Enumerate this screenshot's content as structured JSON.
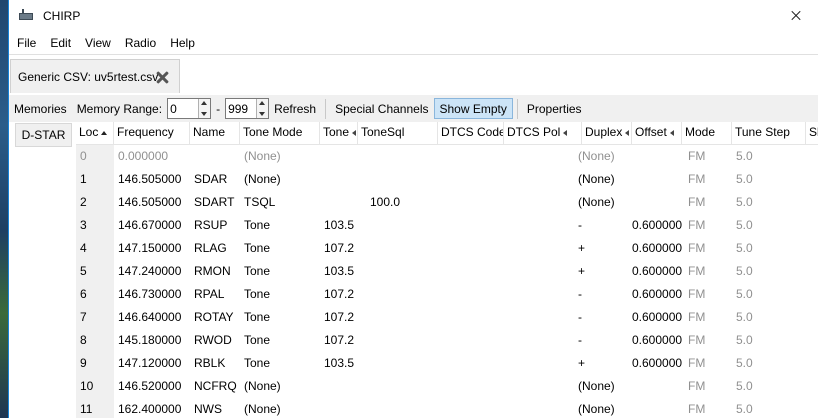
{
  "window": {
    "title": "CHIRP"
  },
  "menu": [
    "File",
    "Edit",
    "View",
    "Radio",
    "Help"
  ],
  "tab": {
    "label": "Generic CSV: uv5rtest.csv"
  },
  "toolbar": {
    "memories_label": "Memories",
    "memory_range_label": "Memory Range:",
    "range_start": "0",
    "range_sep": "-",
    "range_end": "999",
    "refresh": "Refresh",
    "special_channels": "Special Channels",
    "show_empty": "Show Empty",
    "properties": "Properties"
  },
  "sidebar": {
    "tab": "D-STAR"
  },
  "columns": [
    "Loc",
    "Frequency",
    "Name",
    "Tone Mode",
    "Tone",
    "ToneSql",
    "DTCS Code",
    "DTCS Pol",
    "Duplex",
    "Offset",
    "Mode",
    "Tune Step",
    "Sk"
  ],
  "rows": [
    {
      "loc": "0",
      "freq": "0.000000",
      "name": "",
      "tmode": "(None)",
      "tone": "",
      "tsql": "",
      "duplex": "(None)",
      "offset": "",
      "mode": "FM",
      "step": "5.0",
      "empty": true
    },
    {
      "loc": "1",
      "freq": "146.505000",
      "name": "SDAR",
      "tmode": "(None)",
      "tone": "",
      "tsql": "",
      "duplex": "(None)",
      "offset": "",
      "mode": "FM",
      "step": "5.0"
    },
    {
      "loc": "2",
      "freq": "146.505000",
      "name": "SDART",
      "tmode": "TSQL",
      "tone": "",
      "tsql": "100.0",
      "duplex": "(None)",
      "offset": "",
      "mode": "FM",
      "step": "5.0"
    },
    {
      "loc": "3",
      "freq": "146.670000",
      "name": "RSUP",
      "tmode": "Tone",
      "tone": "103.5",
      "tsql": "",
      "duplex": "-",
      "offset": "0.600000",
      "mode": "FM",
      "step": "5.0"
    },
    {
      "loc": "4",
      "freq": "147.150000",
      "name": "RLAG",
      "tmode": "Tone",
      "tone": "107.2",
      "tsql": "",
      "duplex": "+",
      "offset": "0.600000",
      "mode": "FM",
      "step": "5.0"
    },
    {
      "loc": "5",
      "freq": "147.240000",
      "name": "RMON",
      "tmode": "Tone",
      "tone": "103.5",
      "tsql": "",
      "duplex": "+",
      "offset": "0.600000",
      "mode": "FM",
      "step": "5.0"
    },
    {
      "loc": "6",
      "freq": "146.730000",
      "name": "RPAL",
      "tmode": "Tone",
      "tone": "107.2",
      "tsql": "",
      "duplex": "-",
      "offset": "0.600000",
      "mode": "FM",
      "step": "5.0"
    },
    {
      "loc": "7",
      "freq": "146.640000",
      "name": "ROTAY",
      "tmode": "Tone",
      "tone": "107.2",
      "tsql": "",
      "duplex": "-",
      "offset": "0.600000",
      "mode": "FM",
      "step": "5.0"
    },
    {
      "loc": "8",
      "freq": "145.180000",
      "name": "RWOD",
      "tmode": "Tone",
      "tone": "107.2",
      "tsql": "",
      "duplex": "-",
      "offset": "0.600000",
      "mode": "FM",
      "step": "5.0"
    },
    {
      "loc": "9",
      "freq": "147.120000",
      "name": "RBLK",
      "tmode": "Tone",
      "tone": "103.5",
      "tsql": "",
      "duplex": "+",
      "offset": "0.600000",
      "mode": "FM",
      "step": "5.0"
    },
    {
      "loc": "10",
      "freq": "146.520000",
      "name": "NCFRQ",
      "tmode": "(None)",
      "tone": "",
      "tsql": "",
      "duplex": "(None)",
      "offset": "",
      "mode": "FM",
      "step": "5.0"
    },
    {
      "loc": "11",
      "freq": "162.400000",
      "name": "NWS",
      "tmode": "(None)",
      "tone": "",
      "tsql": "",
      "duplex": "(None)",
      "offset": "",
      "mode": "FM",
      "step": "5.0"
    }
  ]
}
